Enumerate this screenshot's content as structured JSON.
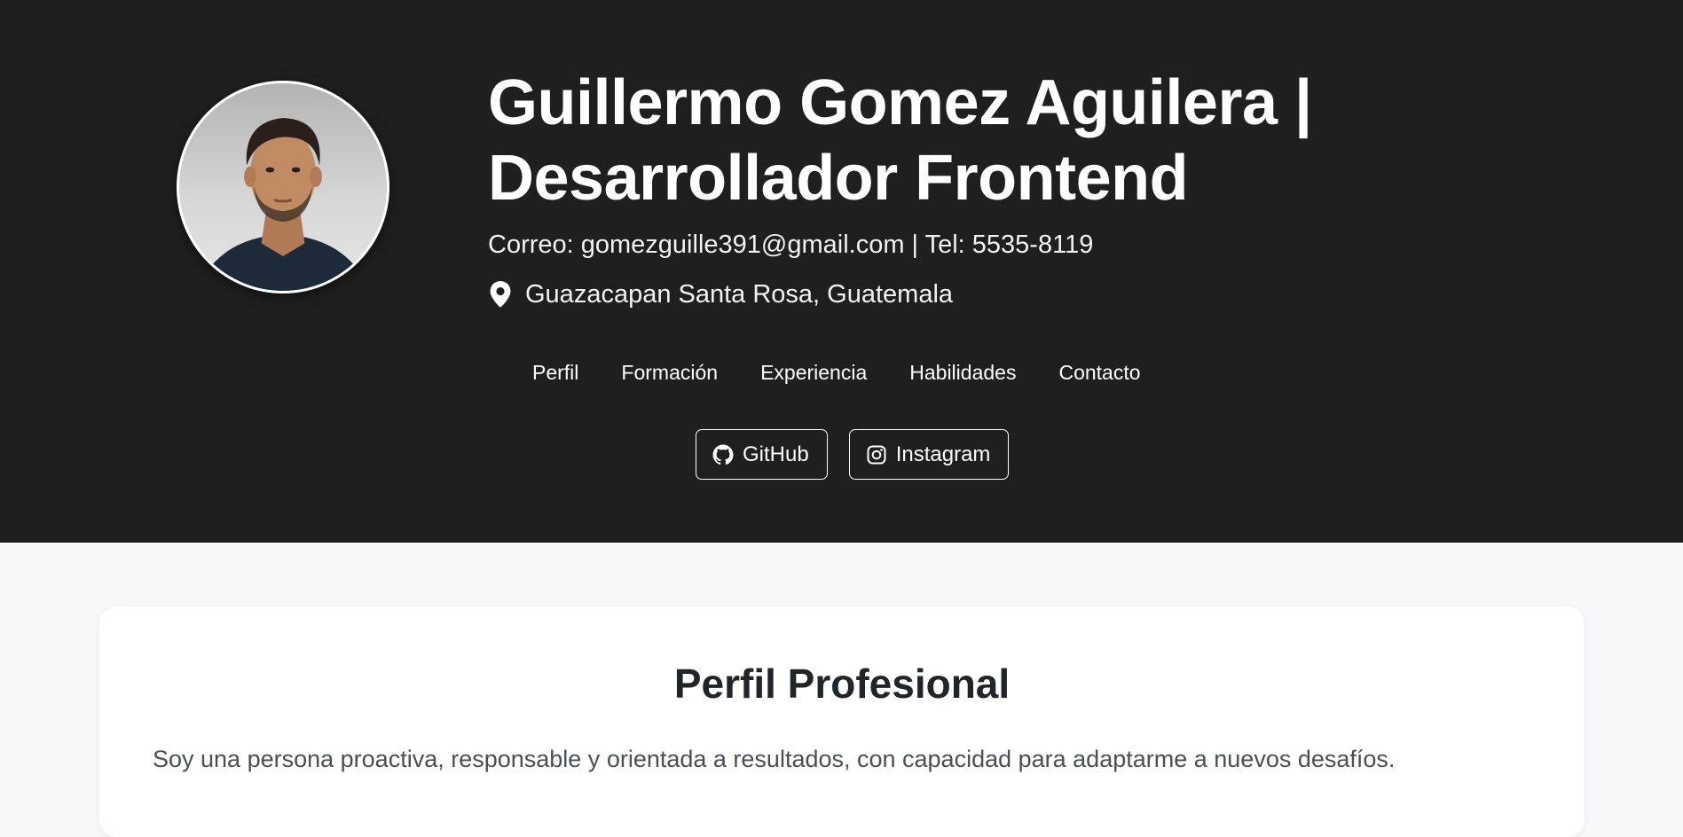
{
  "header": {
    "name_line1": "Guillermo Gomez Aguilera |",
    "name_line2": "Desarrollador Frontend",
    "contact": "Correo: gomezguille391@gmail.com | Tel: 5535-8119",
    "location": "Guazacapan Santa Rosa, Guatemala",
    "location_icon": "map-pin-icon",
    "background_color": "#1f1f1f"
  },
  "nav": {
    "items": [
      {
        "label": "Perfil"
      },
      {
        "label": "Formación"
      },
      {
        "label": "Experiencia"
      },
      {
        "label": "Habilidades"
      },
      {
        "label": "Contacto"
      }
    ]
  },
  "social": {
    "github": {
      "label": "GitHub",
      "icon": "github-icon"
    },
    "instagram": {
      "label": "Instagram",
      "icon": "instagram-icon"
    }
  },
  "profile_section": {
    "title": "Perfil Profesional",
    "text": "Soy una persona proactiva, responsable y orientada a resultados, con capacidad para adaptarme a nuevos desafíos."
  }
}
